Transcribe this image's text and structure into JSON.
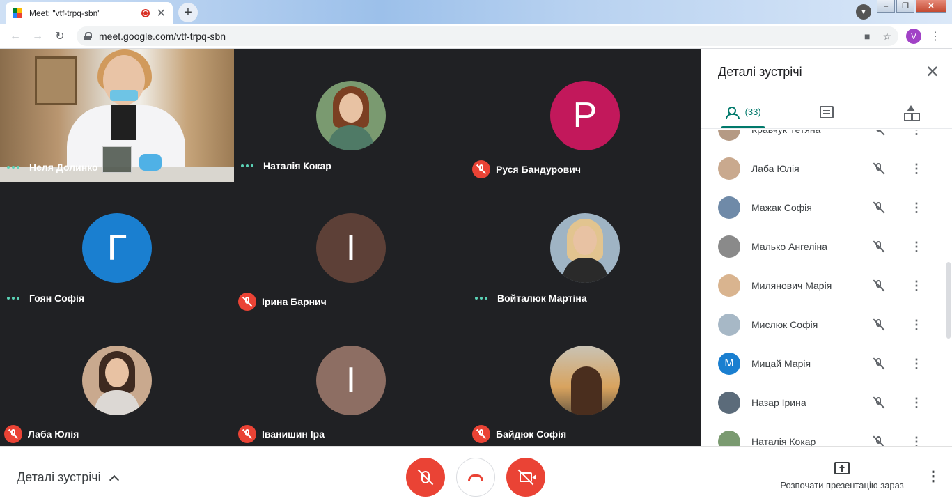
{
  "browser": {
    "tab_title": "Meet: \"vtf-trpq-sbn\"",
    "url": "meet.google.com/vtf-trpq-sbn",
    "profile_initial": "V"
  },
  "grid": {
    "tiles": [
      {
        "name": "Неля Долинко",
        "status": "speaking",
        "kind": "video"
      },
      {
        "name": "Наталія Кокар",
        "status": "speaking",
        "kind": "photo",
        "color": "#7a9a70"
      },
      {
        "name": "Руся Бандурович",
        "status": "muted",
        "kind": "letter",
        "letter": "Р",
        "color": "#c2185b"
      },
      {
        "name": "Гоян Софія",
        "status": "speaking",
        "kind": "letter",
        "letter": "Г",
        "color": "#1a7fd0"
      },
      {
        "name": "Ірина Барнич",
        "status": "muted",
        "kind": "letter",
        "letter": "І",
        "color": "#5d4037"
      },
      {
        "name": "Войталюк Мартіна",
        "status": "speaking",
        "kind": "photo",
        "color": "#9fb4c4"
      },
      {
        "name": "Лаба Юлія",
        "status": "muted",
        "kind": "photo",
        "color": "#c9a98e"
      },
      {
        "name": "Іванишин Іра",
        "status": "muted",
        "kind": "letter",
        "letter": "І",
        "color": "#8d6e63"
      },
      {
        "name": "Байдюк Софія",
        "status": "muted",
        "kind": "photo",
        "color": "#d8a35e"
      }
    ]
  },
  "panel": {
    "title": "Деталі зустрічі",
    "people_count": "(33)",
    "participants": [
      {
        "name": "Кравчук Тетяна",
        "avatar": "photo",
        "color": "#b59a84"
      },
      {
        "name": "Лаба Юлія",
        "avatar": "photo",
        "color": "#c9a98e"
      },
      {
        "name": "Мажак Софія",
        "avatar": "photo",
        "color": "#6f8aa8"
      },
      {
        "name": "Малько Ангеліна",
        "avatar": "photo",
        "color": "#8a8a8a"
      },
      {
        "name": "Милянович Марія",
        "avatar": "photo",
        "color": "#d9b48f"
      },
      {
        "name": "Мислюк Софія",
        "avatar": "photo",
        "color": "#a7b8c6"
      },
      {
        "name": "Мицай Марія",
        "avatar": "letter",
        "letter": "М",
        "color": "#1a7fd0"
      },
      {
        "name": "Назар Ірина",
        "avatar": "photo",
        "color": "#5b6b7a"
      },
      {
        "name": "Наталія Кокар",
        "avatar": "photo",
        "color": "#7a9a70"
      }
    ]
  },
  "bottom": {
    "details_label": "Деталі зустрічі",
    "present_label": "Розпочати презентацію зараз"
  },
  "colors": {
    "accent": "#00796b",
    "danger": "#ea4335",
    "stage_bg": "#202124",
    "speaking_dots": "#5bd3b7"
  }
}
